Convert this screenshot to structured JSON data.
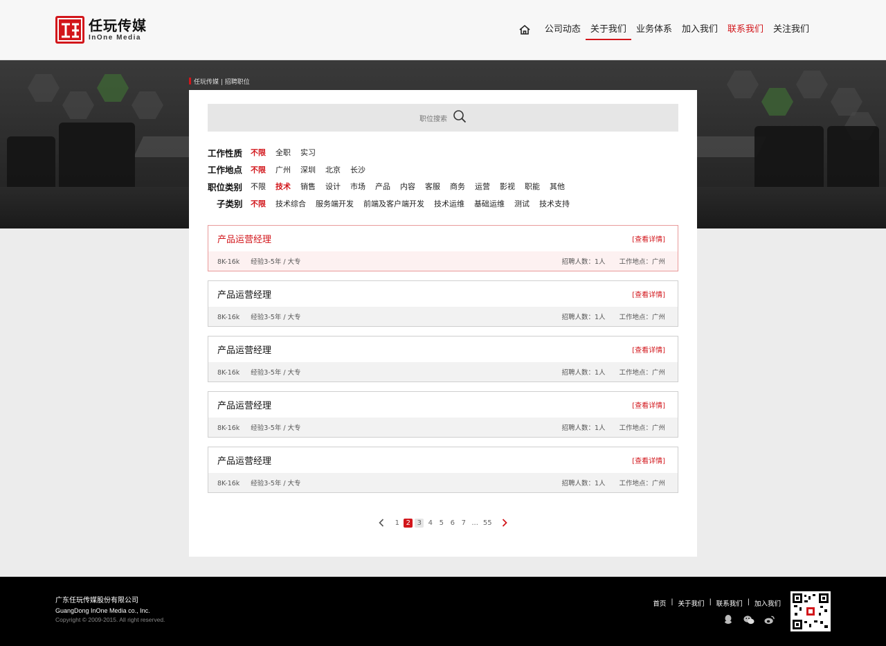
{
  "header": {
    "logo_cn": "任玩传媒",
    "logo_en": "InOne Media",
    "nav": [
      {
        "label": "公司动态"
      },
      {
        "label": "关于我们"
      },
      {
        "label": "业务体系"
      },
      {
        "label": "加入我们"
      },
      {
        "label": "联系我们"
      },
      {
        "label": "关注我们"
      }
    ]
  },
  "breadcrumb": "任玩传媒 | 招聘职位",
  "search": {
    "placeholder": "职位搜索"
  },
  "filters": {
    "nature": {
      "label": "工作性质",
      "options": [
        "不限",
        "全职",
        "实习"
      ]
    },
    "location": {
      "label": "工作地点",
      "options": [
        "不限",
        "广州",
        "深圳",
        "北京",
        "长沙"
      ]
    },
    "category": {
      "label": "职位类别",
      "options": [
        "不限",
        "技术",
        "销售",
        "设计",
        "市场",
        "产品",
        "内容",
        "客服",
        "商务",
        "运营",
        "影视",
        "职能",
        "其他"
      ]
    },
    "subcategory": {
      "label": "子类别",
      "options": [
        "不限",
        "技术综合",
        "服务端开发",
        "前端及客户端开发",
        "技术运维",
        "基础运维",
        "测试",
        "技术支持"
      ]
    }
  },
  "jobs": [
    {
      "title": "产品运营经理",
      "detail": "[查看详情]",
      "salary": "8K-16k",
      "req": "经验3-5年 / 大专",
      "headcount": "招聘人数：1人",
      "place": "工作地点：广州"
    },
    {
      "title": "产品运营经理",
      "detail": "[查看详情]",
      "salary": "8K-16k",
      "req": "经验3-5年 / 大专",
      "headcount": "招聘人数：1人",
      "place": "工作地点：广州"
    },
    {
      "title": "产品运营经理",
      "detail": "[查看详情]",
      "salary": "8K-16k",
      "req": "经验3-5年 / 大专",
      "headcount": "招聘人数：1人",
      "place": "工作地点：广州"
    },
    {
      "title": "产品运营经理",
      "detail": "[查看详情]",
      "salary": "8K-16k",
      "req": "经验3-5年 / 大专",
      "headcount": "招聘人数：1人",
      "place": "工作地点：广州"
    },
    {
      "title": "产品运营经理",
      "detail": "[查看详情]",
      "salary": "8K-16k",
      "req": "经验3-5年 / 大专",
      "headcount": "招聘人数：1人",
      "place": "工作地点：广州"
    }
  ],
  "pager": {
    "pages": [
      "1",
      "2",
      "3",
      "4",
      "5",
      "6",
      "7",
      "...",
      "55"
    ],
    "current": "2"
  },
  "footer": {
    "company_cn": "广东任玩传媒股份有限公司",
    "company_en": "GuangDong InOne Media co., Inc.",
    "copyright": "Copyright © 2009-2015. All right reserved.",
    "links": [
      "首页",
      "关于我们",
      "联系我们",
      "加入我们"
    ]
  },
  "colors": {
    "accent": "#d2161b"
  }
}
